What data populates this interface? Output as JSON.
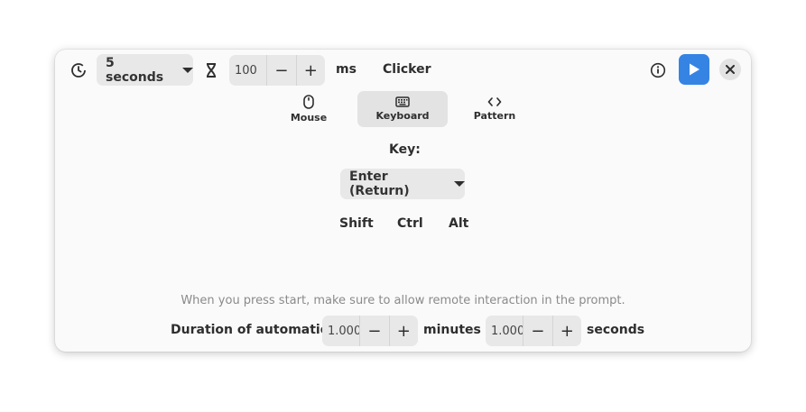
{
  "header": {
    "delay_dropdown": "5 seconds",
    "interval_value": "100",
    "interval_unit": "ms",
    "title": "Clicker",
    "icons": {
      "delay": "timer-icon",
      "interval": "hourglass-icon",
      "info": "info-icon",
      "start": "play-icon",
      "close": "close-icon"
    },
    "start_color": "#3584e4"
  },
  "tabs": [
    {
      "label": "Mouse",
      "icon": "mouse-icon",
      "active": false
    },
    {
      "label": "Keyboard",
      "icon": "keyboard-icon",
      "active": true
    },
    {
      "label": "Pattern",
      "icon": "code-icon",
      "active": false
    }
  ],
  "keyboard": {
    "key_label": "Key:",
    "key_value": "Enter (Return)",
    "modifiers": [
      "Shift",
      "Ctrl",
      "Alt"
    ]
  },
  "footer": {
    "hint": "When you press start, make sure to allow remote interaction in the prompt.",
    "duration_label": "Duration of automation:",
    "minutes_value": "1.000",
    "minutes_unit": "minutes",
    "seconds_value": "1.000",
    "seconds_unit": "seconds"
  }
}
